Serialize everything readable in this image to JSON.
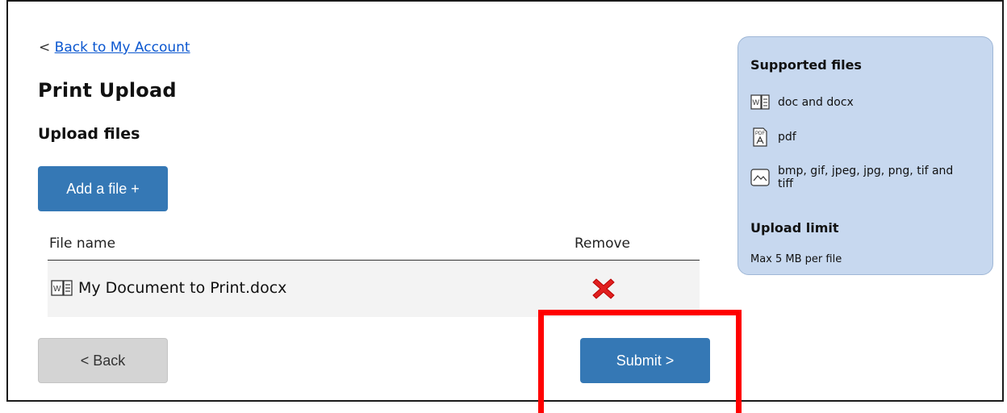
{
  "nav": {
    "back_prefix": "<",
    "back_link": "Back to My Account"
  },
  "page": {
    "title": "Print Upload",
    "section_title": "Upload files"
  },
  "buttons": {
    "add_file": "Add a file +",
    "back": "< Back",
    "submit": "Submit >"
  },
  "table": {
    "columns": [
      "File name",
      "Remove"
    ],
    "rows": [
      {
        "icon": "word-doc-icon",
        "file_name": "My Document to Print.docx",
        "remove_icon": "red-x-icon"
      }
    ]
  },
  "side_panel": {
    "supported_heading": "Supported files",
    "supported": [
      {
        "icon": "word-doc-icon",
        "label": "doc and docx"
      },
      {
        "icon": "pdf-icon",
        "label": "pdf"
      },
      {
        "icon": "image-icon",
        "label": "bmp, gif, jpeg, jpg, png, tif and tiff"
      }
    ],
    "limit_heading": "Upload limit",
    "limit_text": "Max 5 MB per file"
  },
  "colors": {
    "primary_button": "#3578b5",
    "panel_bg": "#c7d8ef",
    "highlight": "#ff0000",
    "remove": "#e02020"
  }
}
